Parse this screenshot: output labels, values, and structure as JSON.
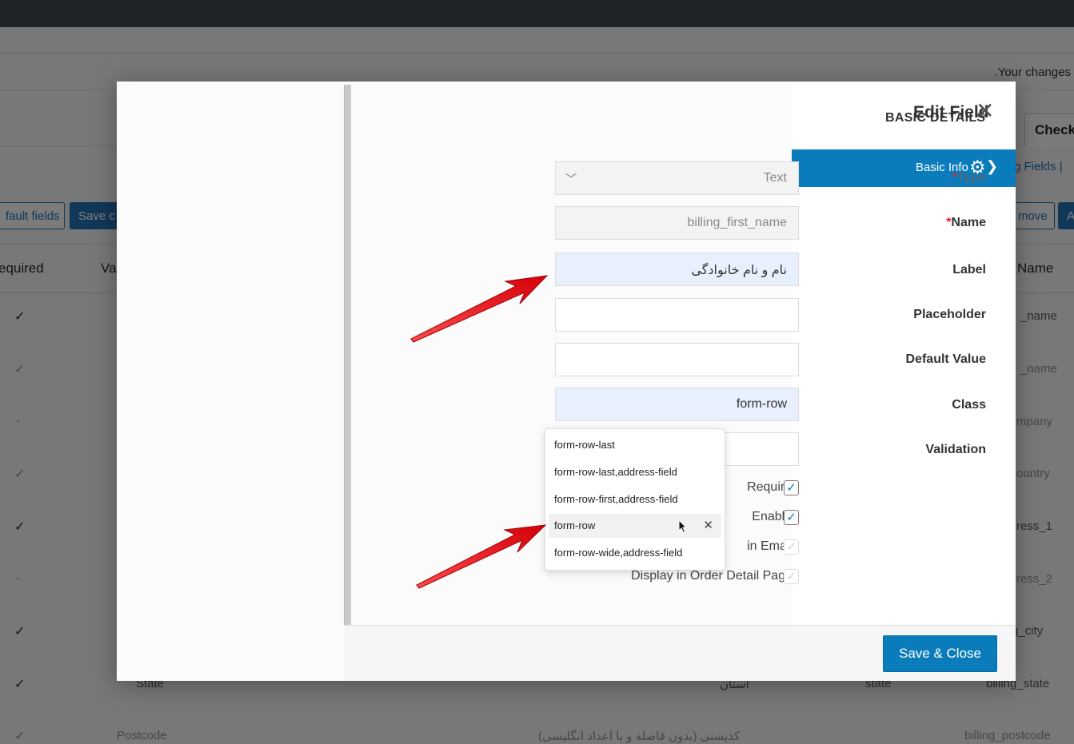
{
  "background": {
    "notice": ".Your changes",
    "tab_checkout": "Check",
    "link_fields": "g Fields |",
    "btn_default_fields": "fault fields",
    "btn_save": "Save c",
    "btn_remove": "move",
    "btn_add": "A",
    "headers": {
      "required": "equired",
      "validation": "Va",
      "name": "Name"
    },
    "rows": [
      {
        "name": "_name"
      },
      {
        "name": "_name"
      },
      {
        "name": "mpany"
      },
      {
        "name": "ountry"
      },
      {
        "name": "ress_1"
      },
      {
        "name": "ress_2"
      },
      {
        "name": "g_city"
      },
      {
        "type": "State",
        "label": "استان",
        "validation": "state",
        "name": "billing_state"
      },
      {
        "type": "Postcode",
        "label": "کدپستی (بدون فاصله و با اعداد انگلیسی)",
        "name": "billing_postcode"
      }
    ]
  },
  "modal": {
    "title": "Edit Field",
    "section_title": "BASIC DETAILS",
    "close_glyph": "✕",
    "tab": {
      "label": "Basic Info",
      "icon": "gear-icon",
      "chevron": "❯"
    },
    "labels": {
      "type": "Type",
      "name": "Name",
      "label": "Label",
      "placeholder": "Placeholder",
      "default_value": "Default Value",
      "class": "Class",
      "validation": "Validation"
    },
    "required_marker": "*",
    "fields": {
      "type": "Text",
      "name": "billing_first_name",
      "label": "نام و نام خانوادگی",
      "placeholder": "",
      "default_value": "",
      "class": "form-row",
      "validation": ""
    },
    "class_options": [
      "form-row-last",
      "form-row-last,address-field",
      "form-row-first,address-field",
      "form-row",
      "form-row-wide,address-field"
    ],
    "selected_option_remove": "✕",
    "checkboxes": [
      {
        "label": "Required",
        "checked": true
      },
      {
        "label": "Enabled",
        "checked": true
      },
      {
        "label": "in Emails",
        "checked": true
      },
      {
        "label": "Display in Order Detail Pages",
        "checked": true
      }
    ],
    "check_glyph": "✓",
    "save_label": "Save & Close"
  },
  "colors": {
    "primary": "#0b7cbb",
    "arrow": "#e8141b",
    "required": "#e02020"
  }
}
